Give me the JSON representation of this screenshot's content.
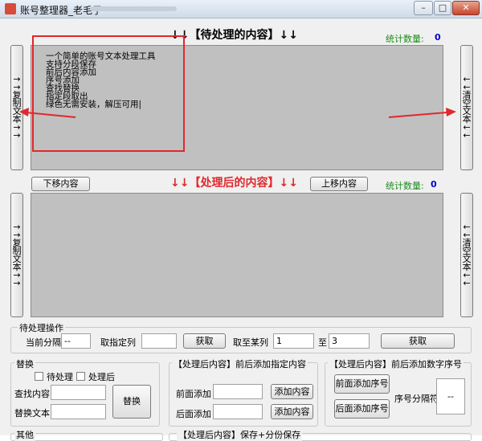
{
  "window": {
    "title": "账号整理器_老毛子",
    "minimize_glyph": "–",
    "maximize_glyph": "□",
    "close_glyph": "✕"
  },
  "top_section": {
    "heading": "↓↓【待处理的内容】↓↓",
    "stat_label": "统计数量:",
    "stat_value": "0",
    "content_lines": [
      "一个简单的账号文本处理工具",
      "支持分段保存",
      "前后内容添加",
      "序号添加",
      "查找替换",
      "指定段取出",
      "绿色无需安装，解压可用|"
    ],
    "left_button": [
      "→",
      "→",
      "复",
      "制",
      "文",
      "本",
      "→",
      "→"
    ],
    "right_button": [
      "←",
      "←",
      "清",
      "空",
      "文",
      "本",
      "←",
      "←"
    ]
  },
  "middle_bar": {
    "move_down_label": "下移内容",
    "move_up_label": "上移内容",
    "heading": "↓↓【处理后的内容】↓↓",
    "stat_label": "统计数量:",
    "stat_value": "0"
  },
  "bottom_section": {
    "left_button": [
      "→",
      "→",
      "复",
      "制",
      "文",
      "本",
      "→",
      "→"
    ],
    "right_button": [
      "←",
      "←",
      "清",
      "空",
      "文",
      "本",
      "←",
      "←"
    ]
  },
  "ops": {
    "group_label": "待处理操作",
    "separator_label": "当前分隔",
    "separator_value": "--",
    "column_label": "取指定列",
    "column_value": "",
    "get_button": "获取",
    "range_label": "取至某列",
    "range_from": "1",
    "range_to_label": "至",
    "range_to": "3",
    "get_button2": "获取"
  },
  "replace": {
    "group_label": "替换",
    "pending_label": "待处理",
    "processed_label": "处理后",
    "find_label": "查找内容",
    "find_value": "",
    "replace_label": "替换文本",
    "replace_value": "",
    "replace_button": "替换"
  },
  "add_content": {
    "group_label": "【处理后内容】前后添加指定内容",
    "prefix_label": "前面添加",
    "prefix_value": "",
    "suffix_label": "后面添加",
    "suffix_value": "",
    "add_button1": "添加内容",
    "add_button2": "添加内容"
  },
  "add_serial": {
    "group_label": "【处理后内容】前后添加数字序号",
    "prefix_button": "前面添加序号",
    "suffix_button": "后面添加序号",
    "separator_label": "序号分隔符",
    "separator_value": "--"
  },
  "bottom_groups": {
    "other_label": "其他",
    "save_label": "【处理后内容】保存+分份保存"
  },
  "colors": {
    "stat_green": "#1c8a1c",
    "stat_blue": "#0000cc",
    "heading_red": "#e0282c",
    "annotation_red": "#e0282c",
    "textarea_gray": "#c0c0c0"
  }
}
